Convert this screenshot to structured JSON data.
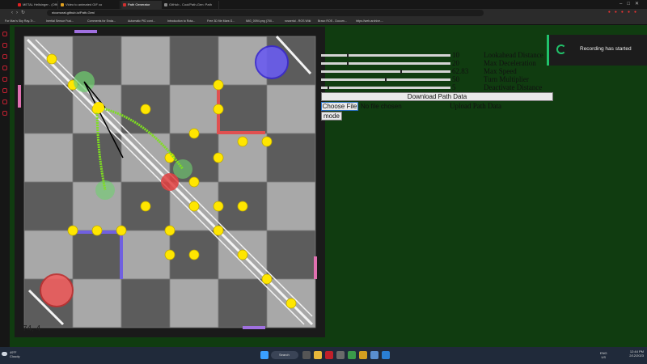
{
  "browser": {
    "tabs": [
      {
        "label": "METAL Hellsinger - (Offi",
        "fav": "#e02020"
      },
      {
        "label": "Video to animated GIF co",
        "fav": "#e0a020"
      },
      {
        "label": "Path Generator",
        "fav": "#d03030",
        "active": true
      },
      {
        "label": "GitHub - Cool/Path-Gen: Path",
        "fav": "#888888"
      }
    ],
    "url": "nicomorat.github.io/Path-Gen/",
    "bookmarks": [
      "For Man's Sky Ray-Tr...",
      "Inertial Sensor Fusi...",
      "Comments for Enda...",
      "Automatic PID cont...",
      "Introduction to Rota...",
      "Free 3D file Mars G...",
      "IMG_0094.png (700...",
      "rosserial - ROS Wiki",
      "Bravo ROS - Docum...",
      "https://web.archive...."
    ]
  },
  "field": {
    "coordinate_readout": "74, 4"
  },
  "controls": {
    "sliders": [
      {
        "value": "10",
        "label": "Lookahead Distance",
        "fraction": 0.2
      },
      {
        "value": "20",
        "label": "Max Deceleration",
        "fraction": 0.2
      },
      {
        "value": "62.83",
        "label": "Max Speed",
        "fraction": 0.62
      },
      {
        "value": "50",
        "label": "Turn Multiplier",
        "fraction": 0.5
      },
      {
        "value": "5",
        "label": "Deactivate Distance",
        "fraction": 0.05
      }
    ],
    "download_label": "Download Path Data",
    "choose_file_label": "Choose File",
    "no_file_text": "No file chosen",
    "upload_label": "Upload Path Data",
    "mode_label": "mode"
  },
  "toast": {
    "message": "Recording has started"
  },
  "taskbar": {
    "weather_temp": "49°F",
    "weather_desc": "Cloudy",
    "search_label": "Search",
    "lang": "ENG",
    "region": "US",
    "time": "12:44 PM",
    "date": "2/12/2023"
  }
}
